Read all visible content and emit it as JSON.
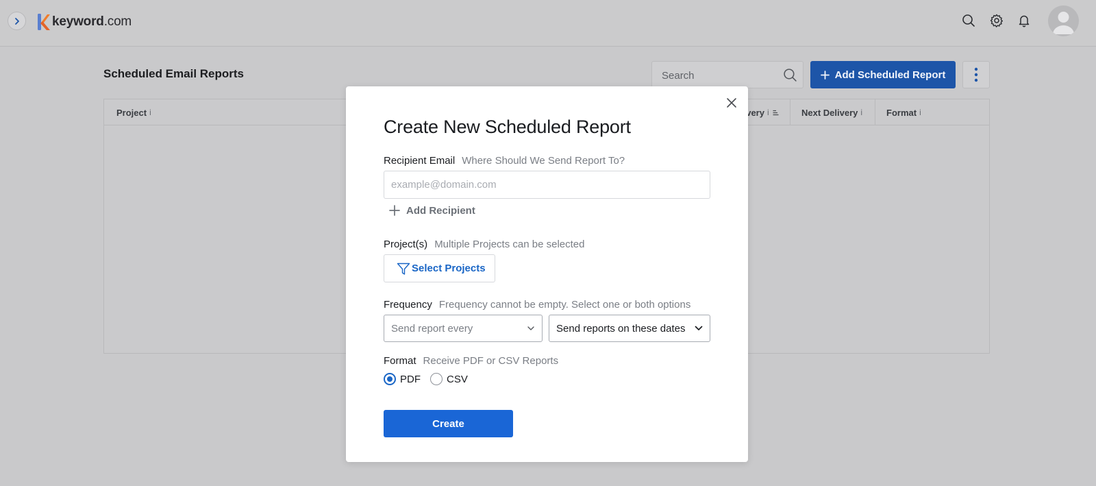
{
  "header": {
    "logo_text": "keyword",
    "logo_suffix": ".com",
    "icons": [
      "chevron-right-icon",
      "search-icon",
      "gear-icon",
      "bell-icon",
      "user-avatar-icon"
    ]
  },
  "page": {
    "title": "Scheduled Email Reports",
    "search_placeholder": "Search",
    "add_button_label": "Add Scheduled Report",
    "table_columns": [
      {
        "label": "Project",
        "info": "i"
      },
      {
        "label": "livery",
        "info": "i"
      },
      {
        "label": "Next Delivery",
        "info": "i"
      },
      {
        "label": "Format",
        "info": "i"
      }
    ]
  },
  "modal": {
    "title": "Create New Scheduled Report",
    "recipient_label": "Recipient Email",
    "recipient_hint": "Where Should We Send Report To?",
    "email_placeholder": "example@domain.com",
    "add_recipient_label": "Add Recipient",
    "projects_label": "Project(s)",
    "projects_hint": "Multiple Projects can be selected",
    "select_projects_label": "Select Projects",
    "frequency_label": "Frequency",
    "frequency_hint": "Frequency cannot be empty. Select one or both options",
    "frequency_every_placeholder": "Send report every",
    "frequency_dates_label": "Send reports on these dates",
    "format_label": "Format",
    "format_hint": "Receive PDF or CSV Reports",
    "format_options": [
      "PDF",
      "CSV"
    ],
    "format_selected": "PDF",
    "create_label": "Create"
  },
  "colors": {
    "primary": "#1a66d6",
    "primary_dark": "#1d55a8",
    "overlay_bg": "#c9c9cb",
    "logo_orange": "#f07c2b",
    "logo_blue": "#2d6cdf"
  }
}
